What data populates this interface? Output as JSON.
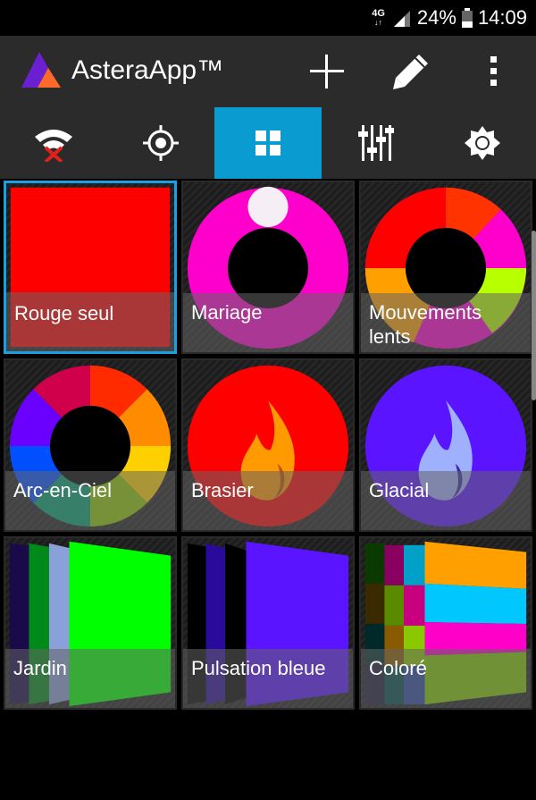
{
  "status_bar": {
    "network": "4G",
    "battery": "24%",
    "time": "14:09"
  },
  "app_bar": {
    "title": "AsteraApp™",
    "actions": [
      {
        "name": "add",
        "icon": "plus-icon"
      },
      {
        "name": "edit",
        "icon": "pencil-icon"
      },
      {
        "name": "more",
        "icon": "overflow-menu-icon"
      }
    ]
  },
  "tabs": [
    {
      "icon": "wifi-off-icon",
      "active": false
    },
    {
      "icon": "crosshair-icon",
      "active": false
    },
    {
      "icon": "grid-icon",
      "active": true
    },
    {
      "icon": "sliders-icon",
      "active": false
    },
    {
      "icon": "brightness-icon",
      "active": false
    }
  ],
  "scenes": [
    {
      "label": "Rouge seul",
      "selected": true
    },
    {
      "label": "Mariage",
      "selected": false
    },
    {
      "label": "Mouvements lents",
      "selected": false
    },
    {
      "label": "Arc-en-Ciel",
      "selected": false
    },
    {
      "label": "Brasier",
      "selected": false
    },
    {
      "label": "Glacial",
      "selected": false
    },
    {
      "label": "Jardin",
      "selected": false
    },
    {
      "label": "Pulsation bleue",
      "selected": false
    },
    {
      "label": "Coloré",
      "selected": false
    }
  ],
  "colors": {
    "accent": "#0a9bd1",
    "bar": "#2b2b2b",
    "red": "#ff0000",
    "magenta": "#ff00cc",
    "violet": "#5a14ff",
    "green": "#00ff00"
  }
}
